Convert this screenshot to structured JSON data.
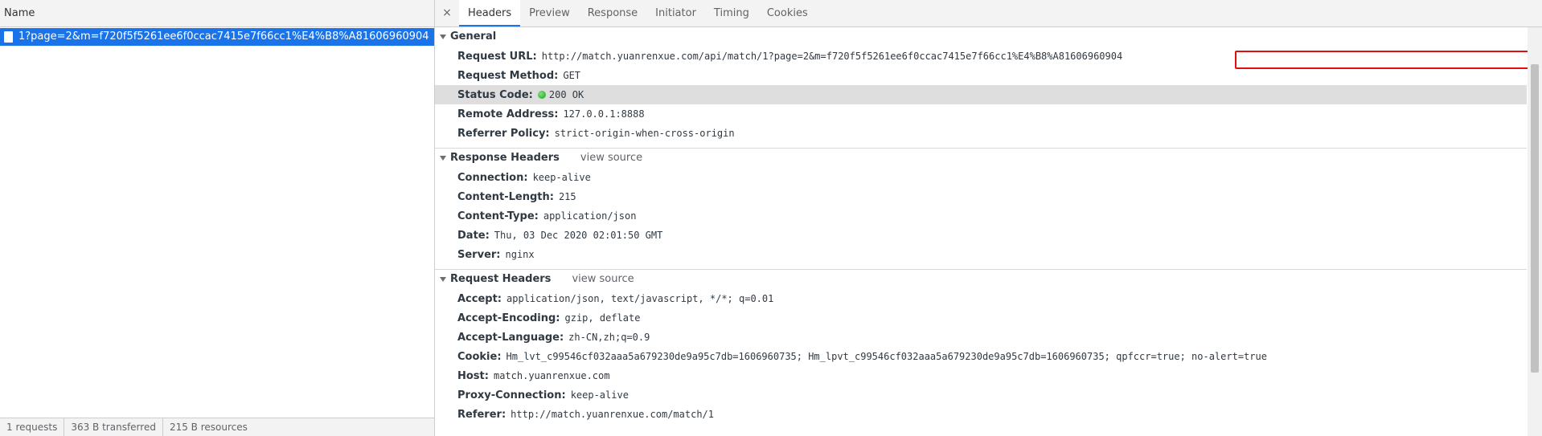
{
  "left": {
    "column_header": "Name",
    "request_name": "1?page=2&m=f720f5f5261ee6f0ccac7415e7f66cc1%E4%B8%A81606960904",
    "status": {
      "requests": "1 requests",
      "transferred": "363 B transferred",
      "resources": "215 B resources"
    }
  },
  "tabs": {
    "close": "×",
    "headers": "Headers",
    "preview": "Preview",
    "response": "Response",
    "initiator": "Initiator",
    "timing": "Timing",
    "cookies": "Cookies"
  },
  "general": {
    "title": "General",
    "request_url_label": "Request URL:",
    "request_url_value": "http://match.yuanrenxue.com/api/match/1?page=2&m=f720f5f5261ee6f0ccac7415e7f66cc1%E4%B8%A81606960904",
    "request_method_label": "Request Method:",
    "request_method_value": "GET",
    "status_code_label": "Status Code:",
    "status_code_value": "200 OK",
    "remote_address_label": "Remote Address:",
    "remote_address_value": "127.0.0.1:8888",
    "referrer_policy_label": "Referrer Policy:",
    "referrer_policy_value": "strict-origin-when-cross-origin"
  },
  "response_headers": {
    "title": "Response Headers",
    "view_source": "view source",
    "rows": [
      {
        "name": "Connection:",
        "value": "keep-alive"
      },
      {
        "name": "Content-Length:",
        "value": "215"
      },
      {
        "name": "Content-Type:",
        "value": "application/json"
      },
      {
        "name": "Date:",
        "value": "Thu, 03 Dec 2020 02:01:50 GMT"
      },
      {
        "name": "Server:",
        "value": "nginx"
      }
    ]
  },
  "request_headers": {
    "title": "Request Headers",
    "view_source": "view source",
    "rows": [
      {
        "name": "Accept:",
        "value": "application/json, text/javascript, */*; q=0.01"
      },
      {
        "name": "Accept-Encoding:",
        "value": "gzip, deflate"
      },
      {
        "name": "Accept-Language:",
        "value": "zh-CN,zh;q=0.9"
      },
      {
        "name": "Cookie:",
        "value": "Hm_lvt_c99546cf032aaa5a679230de9a95c7db=1606960735; Hm_lpvt_c99546cf032aaa5a679230de9a95c7db=1606960735; qpfccr=true; no-alert=true"
      },
      {
        "name": "Host:",
        "value": "match.yuanrenxue.com"
      },
      {
        "name": "Proxy-Connection:",
        "value": "keep-alive"
      },
      {
        "name": "Referer:",
        "value": "http://match.yuanrenxue.com/match/1"
      }
    ]
  },
  "colors": {
    "accent": "#1a73e8",
    "highlight_border": "#e01010",
    "status_ok": "#15a515"
  }
}
